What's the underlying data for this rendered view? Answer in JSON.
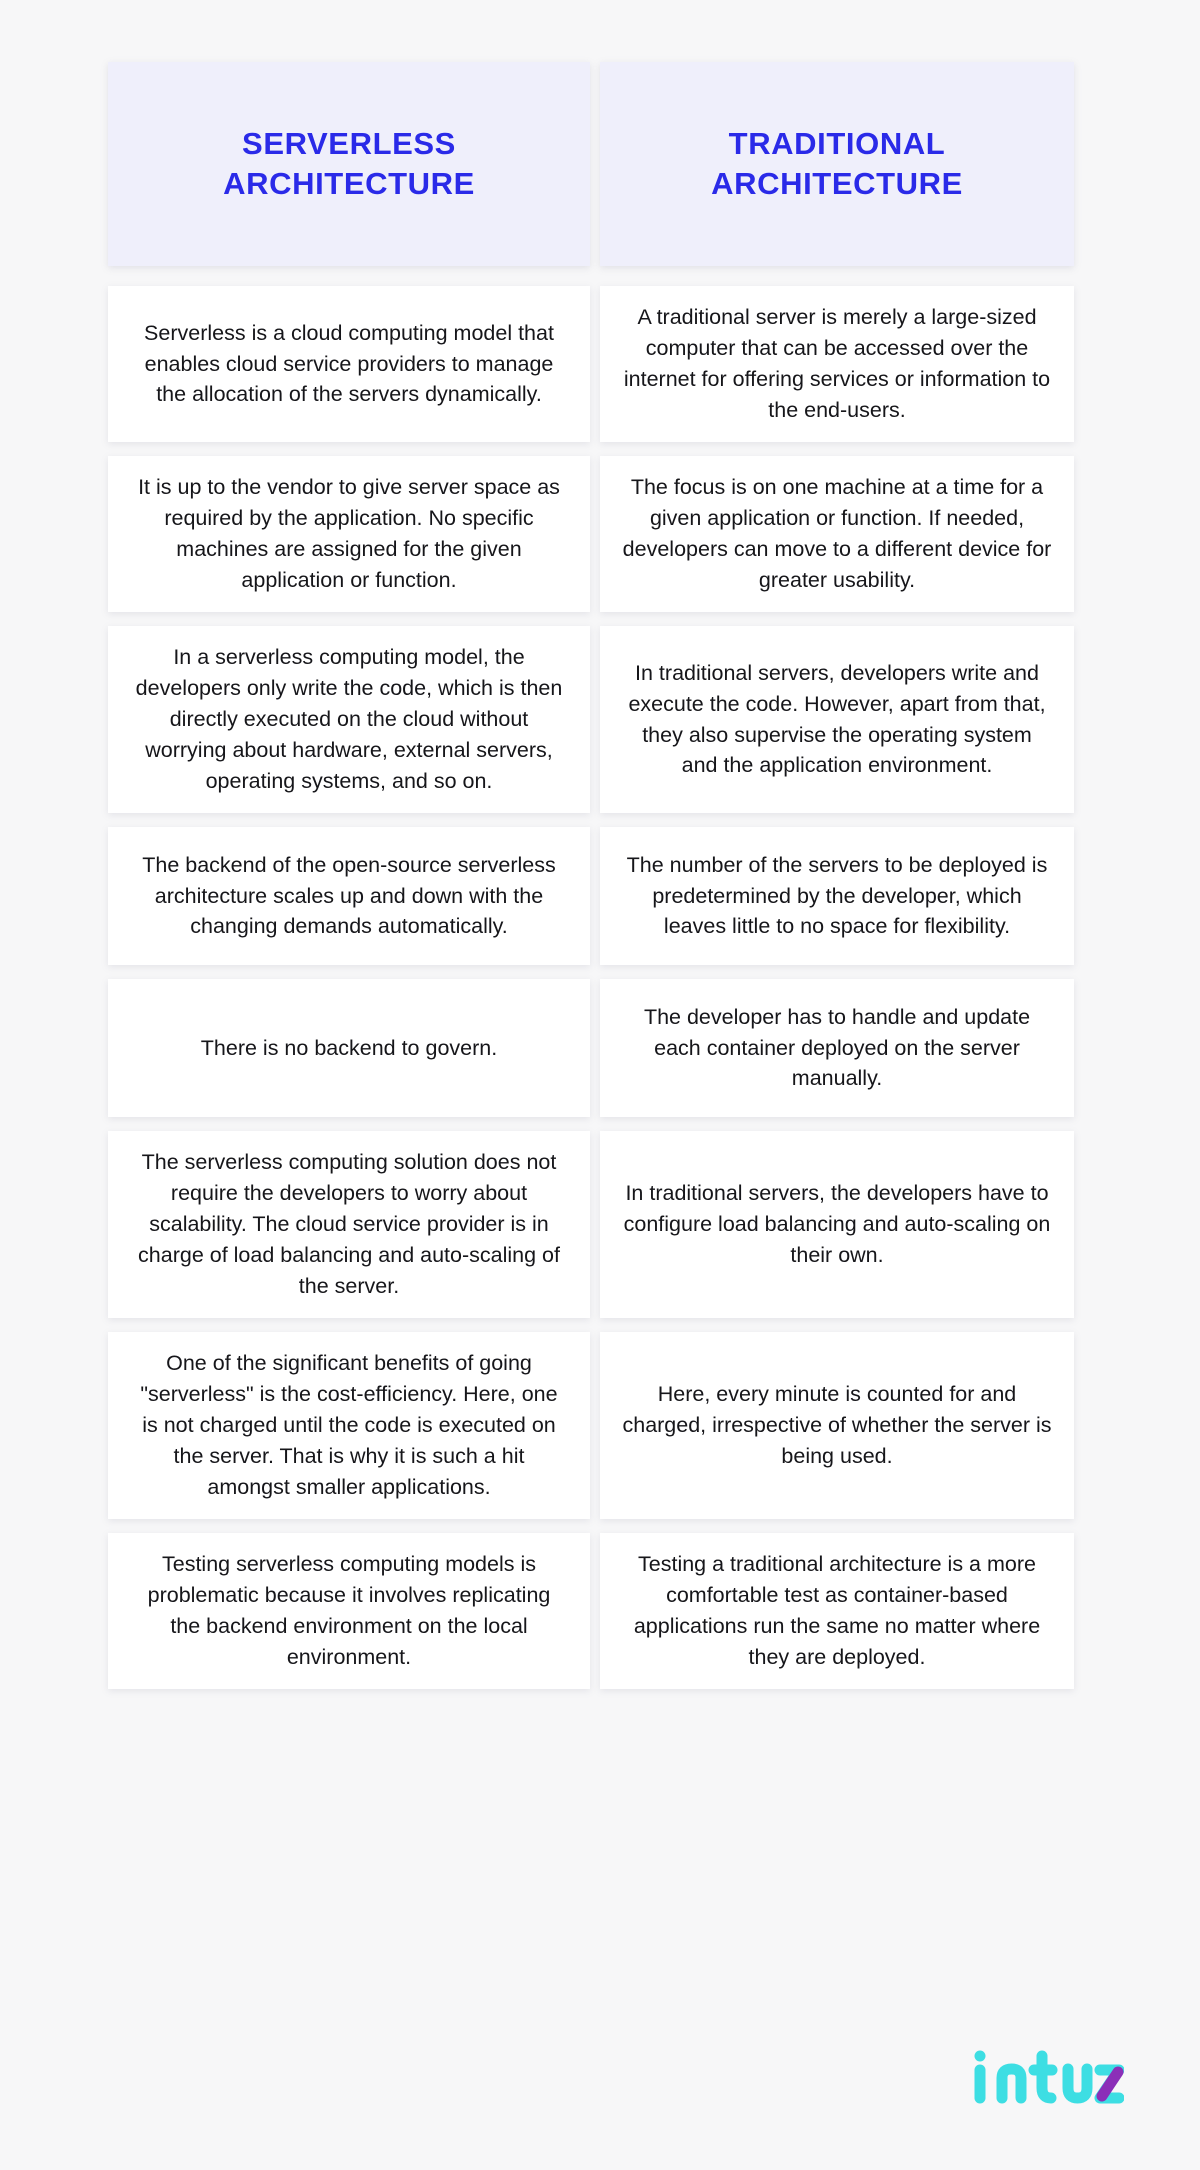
{
  "page": {
    "background_color": "#f7f7f8",
    "heading_color": "#2a2ae8",
    "header_card_color": "#efeffb",
    "cell_color": "#ffffff",
    "body_text_color": "#16161a"
  },
  "columns": [
    {
      "title": "Serverless Architecture"
    },
    {
      "title": "Traditional Architecture"
    }
  ],
  "rows": [
    {
      "left": "Serverless is a cloud computing model that enables cloud service providers to manage the allocation of the servers dynamically.",
      "right": "A traditional server is merely a large-sized computer that can be accessed over the internet for offering services or information to the end-users."
    },
    {
      "left": "It is up to the vendor to give server space as required by the application. No specific machines are assigned for the given application or function.",
      "right": "The focus is on one machine at a time for a given application or function. If needed, developers can move to a different device for greater usability."
    },
    {
      "left": "In a serverless computing model, the developers only write the code, which is then directly executed on the cloud without worrying about hardware, external servers, operating systems, and so on.",
      "right": "In traditional servers, developers write and execute the code. However, apart from that, they also supervise the operating system and the application environment."
    },
    {
      "left": "The backend of the open-source serverless architecture scales up and down with the changing demands automatically.",
      "right": "The number of the servers to be deployed is predetermined by the developer, which leaves little to no space for flexibility."
    },
    {
      "left": "There is no backend to govern.",
      "right": "The developer has to handle and update each container deployed on the server manually."
    },
    {
      "left": "The serverless computing solution does not require the developers to worry about scalability. The cloud service provider is in charge of load balancing and auto-scaling of the server.",
      "right": "In traditional servers, the developers have to configure load balancing and auto-scaling on their own."
    },
    {
      "left": "One of the significant benefits of going \"serverless\" is the cost-efficiency. Here, one is not charged until the code is executed on the server. That is why it is such a hit amongst smaller applications.",
      "right": "Here, every minute is counted for and charged, irrespective of whether the server is being used."
    },
    {
      "left": "Testing serverless computing models is problematic because it involves replicating the backend environment on the local environment.",
      "right": "Testing a traditional architecture is a more comfortable test as container-based applications run the same no matter where they are deployed."
    }
  ],
  "logo": {
    "name": "intuz",
    "text": "intuz",
    "primary_color": "#3ddee3",
    "accent_color": "#8b2fb8"
  }
}
